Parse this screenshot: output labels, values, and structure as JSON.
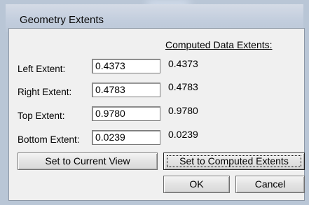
{
  "window": {
    "title": "Geometry Extents"
  },
  "labels": {
    "computed_header": "Computed Data Extents:",
    "left": "Left Extent:",
    "right": "Right Extent:",
    "top": "Top Extent:",
    "bottom": "Bottom Extent:"
  },
  "fields": {
    "left": "0.4373",
    "right": "0.4783",
    "top": "0.9780",
    "bottom": "0.0239"
  },
  "computed": {
    "left": "0.4373",
    "right": "0.4783",
    "top": "0.9780",
    "bottom": "0.0239"
  },
  "buttons": {
    "set_current_view": "Set to Current View",
    "set_computed": "Set to Computed Extents",
    "ok": "OK",
    "cancel": "Cancel"
  }
}
